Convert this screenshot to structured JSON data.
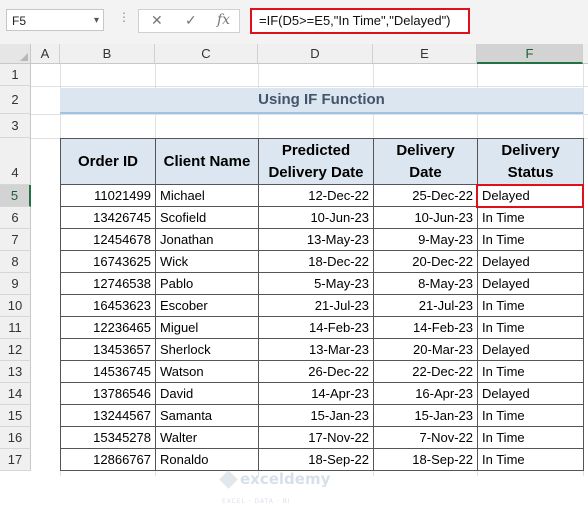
{
  "formula_bar": {
    "name_box": "F5",
    "cancel_icon": "✕",
    "enter_icon": "✓",
    "fx_label": "fx",
    "formula": "=IF(D5>=E5,\"In Time\",\"Delayed\")"
  },
  "columns": [
    "A",
    "B",
    "C",
    "D",
    "E",
    "F"
  ],
  "rows": [
    "1",
    "2",
    "3",
    "4",
    "5",
    "6",
    "7",
    "8",
    "9",
    "10",
    "11",
    "12",
    "13",
    "14",
    "15",
    "16",
    "17"
  ],
  "title": "Using IF Function",
  "headers": {
    "order_id": "Order ID",
    "client_name": "Client Name",
    "predicted_line1": "Predicted",
    "predicted_line2": "Delivery Date",
    "delivery_line1": "Delivery",
    "delivery_line2": "Date",
    "status_line1": "Delivery",
    "status_line2": "Status"
  },
  "records": [
    {
      "id": "11021499",
      "client": "Michael",
      "predicted": "12-Dec-22",
      "delivery": "25-Dec-22",
      "status": "Delayed"
    },
    {
      "id": "13426745",
      "client": "Scofield",
      "predicted": "10-Jun-23",
      "delivery": "10-Jun-23",
      "status": "In Time"
    },
    {
      "id": "12454678",
      "client": "Jonathan",
      "predicted": "13-May-23",
      "delivery": "9-May-23",
      "status": "In Time"
    },
    {
      "id": "16743625",
      "client": "Wick",
      "predicted": "18-Dec-22",
      "delivery": "20-Dec-22",
      "status": "Delayed"
    },
    {
      "id": "12746538",
      "client": "Pablo",
      "predicted": "5-May-23",
      "delivery": "8-May-23",
      "status": "Delayed"
    },
    {
      "id": "16453623",
      "client": "Escober",
      "predicted": "21-Jul-23",
      "delivery": "21-Jul-23",
      "status": "In Time"
    },
    {
      "id": "12236465",
      "client": "Miguel",
      "predicted": "14-Feb-23",
      "delivery": "14-Feb-23",
      "status": "In Time"
    },
    {
      "id": "13453657",
      "client": "Sherlock",
      "predicted": "13-Mar-23",
      "delivery": "20-Mar-23",
      "status": "Delayed"
    },
    {
      "id": "14536745",
      "client": "Watson",
      "predicted": "26-Dec-22",
      "delivery": "22-Dec-22",
      "status": "In Time"
    },
    {
      "id": "13786546",
      "client": "David",
      "predicted": "14-Apr-23",
      "delivery": "16-Apr-23",
      "status": "Delayed"
    },
    {
      "id": "13244567",
      "client": "Samanta",
      "predicted": "15-Jan-23",
      "delivery": "15-Jan-23",
      "status": "In Time"
    },
    {
      "id": "15345278",
      "client": "Walter",
      "predicted": "17-Nov-22",
      "delivery": "7-Nov-22",
      "status": "In Time"
    },
    {
      "id": "12866767",
      "client": "Ronaldo",
      "predicted": "18-Sep-22",
      "delivery": "18-Sep-22",
      "status": "In Time"
    }
  ],
  "watermark": {
    "main": "exceldemy",
    "sub": "EXCEL · DATA · BI"
  }
}
